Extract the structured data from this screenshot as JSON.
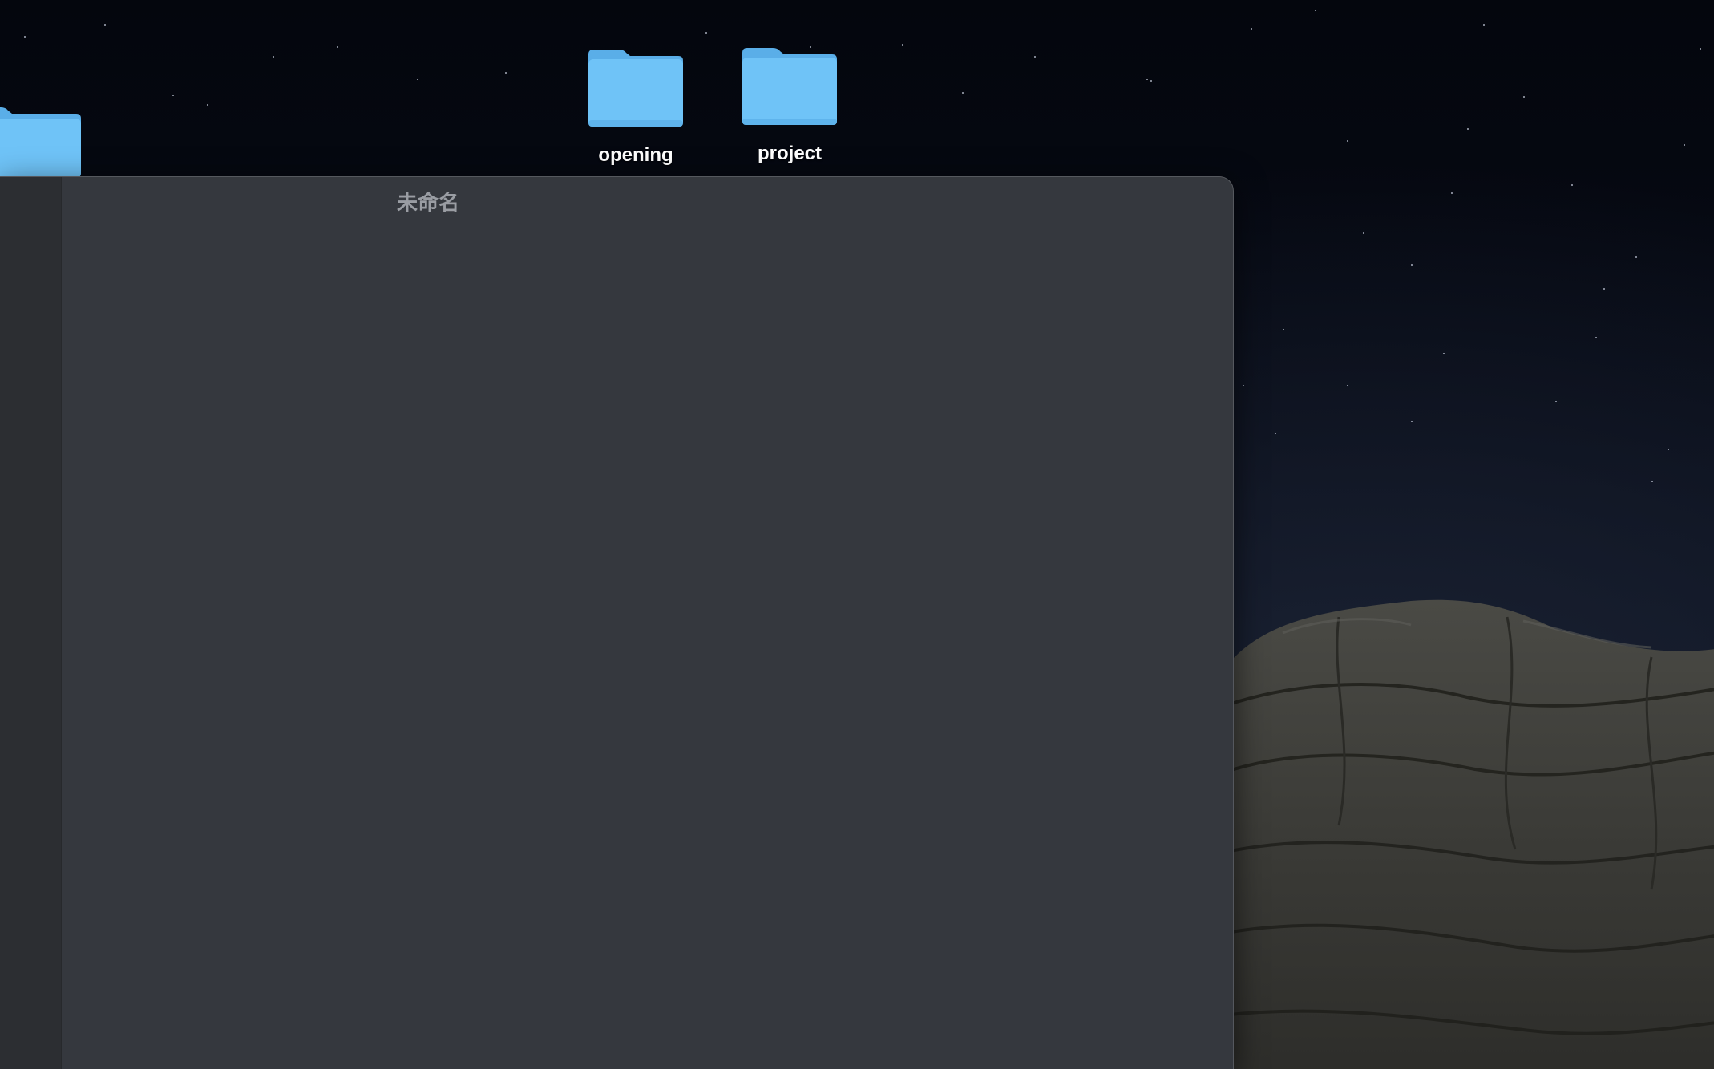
{
  "desktop": {
    "icons": [
      {
        "label": "",
        "icon": "folder-icon"
      },
      {
        "label": "opening",
        "icon": "folder-icon"
      },
      {
        "label": "project",
        "icon": "folder-icon"
      }
    ]
  },
  "window": {
    "title": "未命名"
  },
  "colors": {
    "folder": "#6fc3f7",
    "folder_tab": "#5aaee8",
    "window_bg": "#35383e",
    "sidebar_bg": "#2c2e32",
    "title_text": "#9a9da3"
  }
}
